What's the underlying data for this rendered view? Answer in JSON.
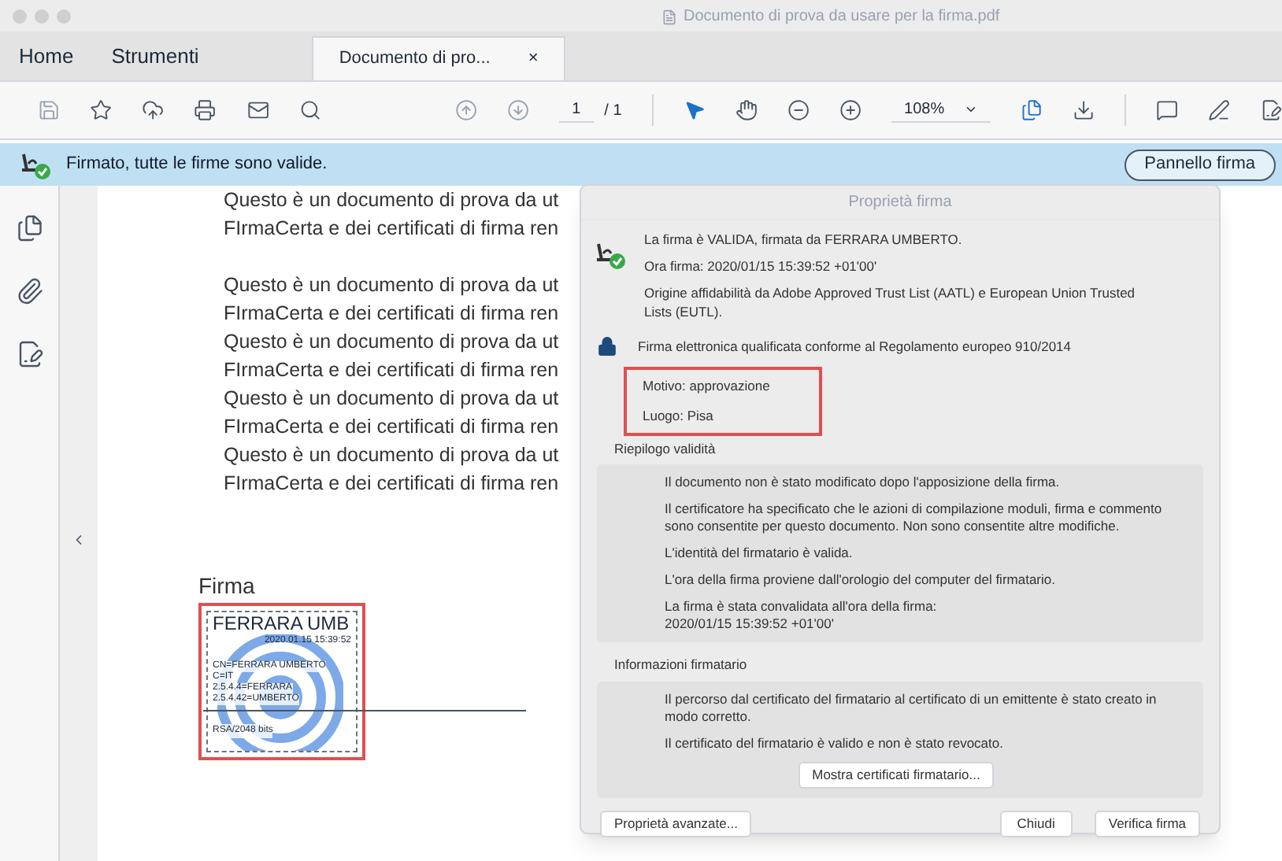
{
  "window": {
    "title": "Documento di prova da usare per la firma.pdf"
  },
  "tabs": [
    {
      "label": "Home",
      "selected": false,
      "kind": "nav"
    },
    {
      "label": "Strumenti",
      "selected": false,
      "kind": "nav"
    },
    {
      "label": "Documento di pro...",
      "selected": true,
      "kind": "doc",
      "close": "×"
    }
  ],
  "toolbar": {
    "page": "1",
    "page_total": "/ 1",
    "zoom": "108%"
  },
  "notification": {
    "message": "Firmato, tutte le firme sono valide.",
    "button": "Pannello firma"
  },
  "document": {
    "paragraphs": [
      [
        "Questo è un documento di prova da ut",
        "FIrmaCerta e dei certificati di firma ren"
      ],
      [
        "Questo è un documento di prova da ut",
        "FIrmaCerta e dei certificati di firma ren",
        "Questo è un documento di prova da ut",
        "FIrmaCerta e dei certificati di firma ren",
        "Questo è un documento di prova da ut",
        "FIrmaCerta e dei certificati di firma ren",
        "Questo è un documento di prova da ut",
        "FIrmaCerta e dei certificati di firma ren"
      ]
    ],
    "signature_label": "Firma",
    "stamp": {
      "name": "FERRARA UMB",
      "date": "2020.01.15 15:39:52",
      "details": [
        "CN=FERRARA UMBERTO",
        "C=IT",
        "2.5.4.4=FERRARA",
        "2.5.4.42=UMBERTO"
      ],
      "algorithm": "RSA/2048 bits"
    }
  },
  "dialog": {
    "title": "Proprietà firma",
    "summary": [
      "La firma è VALIDA, firmata da FERRARA UMBERTO.",
      "Ora firma:  2020/01/15 15:39:52 +01'00'",
      "Origine affidabilità da Adobe Approved Trust List (AATL) e European Union Trusted Lists (EUTL)."
    ],
    "qualified": "Firma elettronica qualificata conforme al Regolamento europeo 910/2014",
    "reason": "Motivo:  approvazione",
    "location": "Luogo:  Pisa",
    "validity_title": "Riepilogo validità",
    "validity": [
      "Il documento non è stato modificato dopo l'apposizione della firma.",
      "Il certificatore ha specificato che le azioni di compilazione moduli, firma e commento sono consentite per questo documento. Non sono consentite altre modifiche.",
      "L'identità del firmatario è valida.",
      "L'ora della firma proviene dall'orologio del computer del firmatario.",
      "La firma è stata convalidata all'ora della firma:\n2020/01/15 15:39:52 +01'00'"
    ],
    "signer_title": "Informazioni firmatario",
    "signer": [
      "Il percorso dal certificato del firmatario al certificato di un emittente è stato creato in modo corretto.",
      "Il certificato del firmatario è valido e non è stato revocato."
    ],
    "show_certs": "Mostra certificati firmatario...",
    "advanced": "Proprietà avanzate...",
    "close": "Chiudi",
    "verify": "Verifica firma"
  }
}
